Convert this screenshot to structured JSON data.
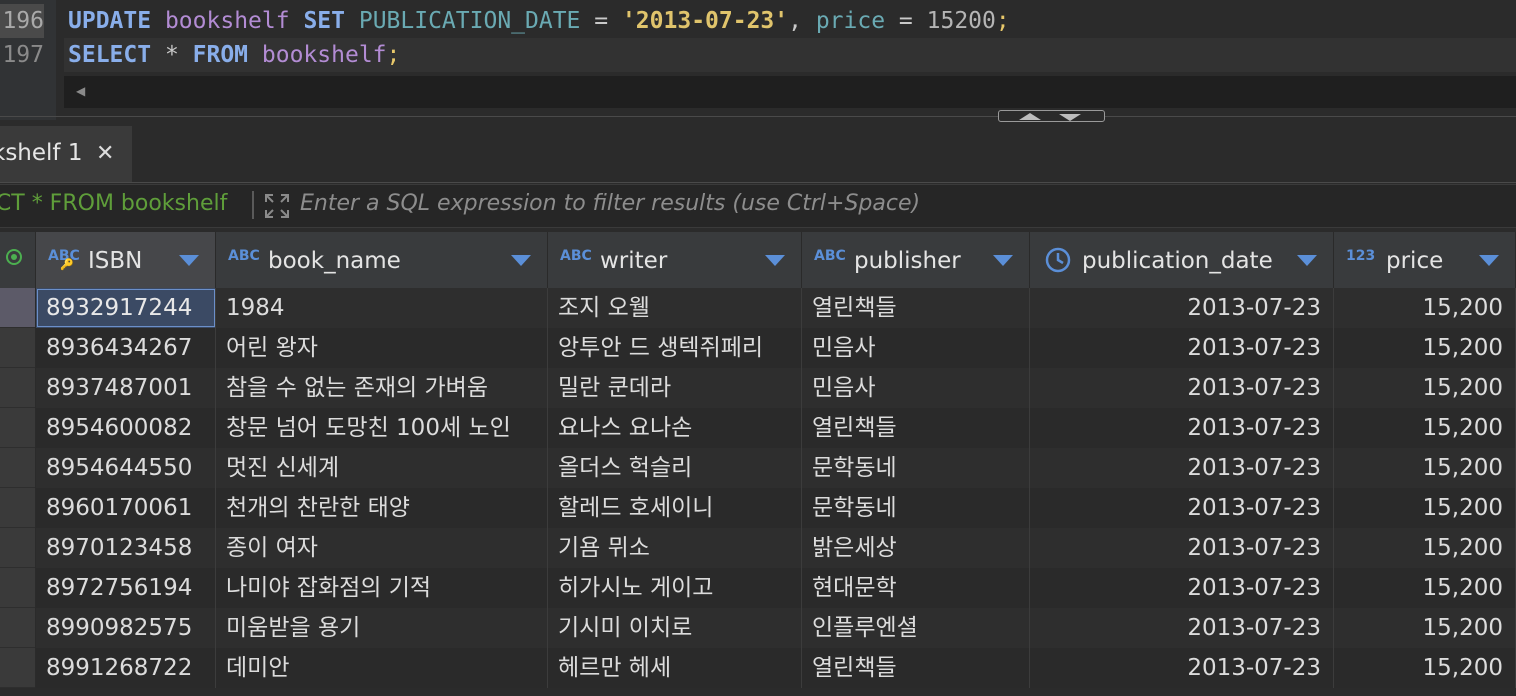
{
  "editor": {
    "lines": [
      {
        "number": "196",
        "tokens": [
          {
            "t": "UPDATE",
            "c": "kw"
          },
          {
            "t": " ",
            "c": "op"
          },
          {
            "t": "bookshelf",
            "c": "tbl"
          },
          {
            "t": " ",
            "c": "op"
          },
          {
            "t": "SET",
            "c": "kw"
          },
          {
            "t": " ",
            "c": "op"
          },
          {
            "t": "PUBLICATION_DATE",
            "c": "col"
          },
          {
            "t": " = ",
            "c": "op"
          },
          {
            "t": "'2013-07-23'",
            "c": "str"
          },
          {
            "t": ", ",
            "c": "op"
          },
          {
            "t": "price",
            "c": "col"
          },
          {
            "t": " = ",
            "c": "op"
          },
          {
            "t": "15200",
            "c": "num"
          },
          {
            "t": ";",
            "c": "semi"
          }
        ]
      },
      {
        "number": "197",
        "tokens": [
          {
            "t": "SELECT",
            "c": "kw"
          },
          {
            "t": " * ",
            "c": "op"
          },
          {
            "t": "FROM",
            "c": "kw"
          },
          {
            "t": " ",
            "c": "op"
          },
          {
            "t": "bookshelf",
            "c": "tbl"
          },
          {
            "t": ";",
            "c": "semi"
          }
        ]
      }
    ]
  },
  "results_tab": {
    "label": "kshelf 1"
  },
  "filter": {
    "query": "ECT * FROM bookshelf",
    "placeholder": "Enter a SQL expression to filter results (use Ctrl+Space)"
  },
  "grid": {
    "columns": [
      {
        "type": "ABC",
        "label": "ISBN",
        "key": true
      },
      {
        "type": "ABC",
        "label": "book_name"
      },
      {
        "type": "ABC",
        "label": "writer"
      },
      {
        "type": "ABC",
        "label": "publisher"
      },
      {
        "type": "clock",
        "label": "publication_date"
      },
      {
        "type": "123",
        "label": "price"
      }
    ],
    "rows": [
      [
        "8932917244",
        "1984",
        "조지 오웰",
        "열린책들",
        "2013-07-23",
        "15,200"
      ],
      [
        "8936434267",
        "어린 왕자",
        "앙투안 드 생텍쥐페리",
        "민음사",
        "2013-07-23",
        "15,200"
      ],
      [
        "8937487001",
        "참을 수 없는 존재의 가벼움",
        "밀란 쿤데라",
        "민음사",
        "2013-07-23",
        "15,200"
      ],
      [
        "8954600082",
        "창문 넘어 도망친 100세 노인",
        "요나스 요나손",
        "열린책들",
        "2013-07-23",
        "15,200"
      ],
      [
        "8954644550",
        "멋진 신세계",
        "올더스 헉슬리",
        "문학동네",
        "2013-07-23",
        "15,200"
      ],
      [
        "8960170061",
        "천개의 찬란한 태양",
        "할레드 호세이니",
        "문학동네",
        "2013-07-23",
        "15,200"
      ],
      [
        "8970123458",
        "종이 여자",
        "기욤 뮈소",
        "밝은세상",
        "2013-07-23",
        "15,200"
      ],
      [
        "8972756194",
        "나미야 잡화점의 기적",
        "히가시노 게이고",
        "현대문학",
        "2013-07-23",
        "15,200"
      ],
      [
        "8990982575",
        "미움받을 용기",
        "기시미 이치로",
        "인플루엔셜",
        "2013-07-23",
        "15,200"
      ],
      [
        "8991268722",
        "데미안",
        "헤르만 헤세",
        "열린책들",
        "2013-07-23",
        "15,200"
      ]
    ]
  }
}
